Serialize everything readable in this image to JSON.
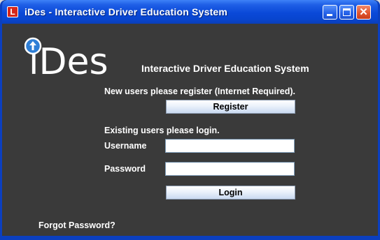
{
  "window": {
    "title": "iDes - Interactive Driver Education System",
    "app_icon_glyph": "L",
    "controls": {
      "minimize_icon": "minimize-icon",
      "maximize_icon": "maximize-icon",
      "close_icon": "close-icon",
      "close_glyph": "✕"
    }
  },
  "branding": {
    "logo_text": "iDes",
    "subtitle": "Interactive Driver Education System"
  },
  "register": {
    "prompt": "New users please register (Internet Required).",
    "button_label": "Register"
  },
  "login": {
    "prompt": "Existing users please login.",
    "username_label": "Username",
    "username_value": "",
    "password_label": "Password",
    "password_value": "",
    "button_label": "Login"
  },
  "forgot_password": "Forgot Password?",
  "colors": {
    "titlebar": "#0a49d8",
    "background": "#3a3a3a",
    "logo_circle": "#2f7fd6",
    "text": "#ffffff"
  }
}
